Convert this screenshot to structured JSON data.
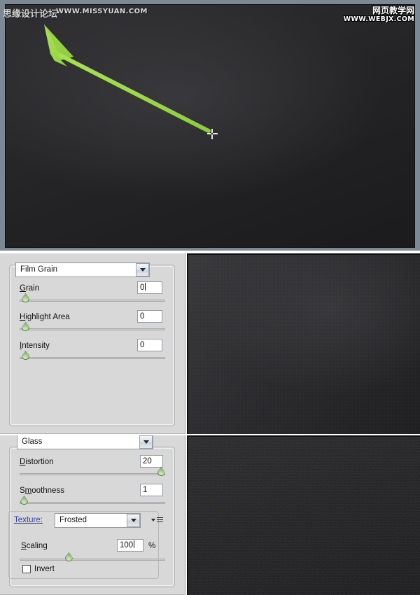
{
  "canvas": {
    "name": "photoshop-document-canvas",
    "arrow": {
      "color": "#9ed94a",
      "description": "green arrow pointing up-left"
    },
    "cursor": "move-crosshair-cursor",
    "watermarks": {
      "left_cn": "思缘设计论坛",
      "left_url": "WWW.MISSYUAN.COM",
      "right_cn": "网页教学网",
      "right_url": "WWW.WEBJX.COM"
    }
  },
  "filters": [
    {
      "id": "film-grain",
      "name": "Film Grain",
      "controls": [
        {
          "label": "Grain",
          "accel": "G",
          "rest": "rain",
          "value": "0",
          "caret": true,
          "slider_pct": 2
        },
        {
          "label": "Highlight Area",
          "accel": "H",
          "rest": "ighlight Area",
          "value": "0",
          "caret": false,
          "slider_pct": 2
        },
        {
          "label": "Intensity",
          "accel": "I",
          "rest": "ntensity",
          "value": "0",
          "caret": false,
          "slider_pct": 2
        }
      ]
    },
    {
      "id": "glass",
      "name": "Glass",
      "controls": [
        {
          "label": "Distortion",
          "accel": "D",
          "rest": "istortion",
          "value": "20",
          "caret": false,
          "slider_pct": 96
        },
        {
          "label": "Smoothness",
          "accel": "m",
          "rest": "oothness",
          "prefix": "S",
          "value": "1",
          "caret": false,
          "slider_pct": 1
        }
      ],
      "texture": {
        "label": "Texture:",
        "selected": "Frosted",
        "menu_icon": "flyout-menu-icon",
        "scaling": {
          "label": "Scaling",
          "accel": "S",
          "rest": "caling",
          "value": "100",
          "caret": true,
          "unit": "%",
          "slider_pct": 33
        },
        "invert": {
          "label": "Invert",
          "accel": "I",
          "rest": "nvert",
          "checked": false
        }
      }
    }
  ],
  "previews": [
    {
      "name": "film-grain-preview",
      "filter": "Film Grain"
    },
    {
      "name": "glass-preview",
      "filter": "Glass"
    }
  ]
}
